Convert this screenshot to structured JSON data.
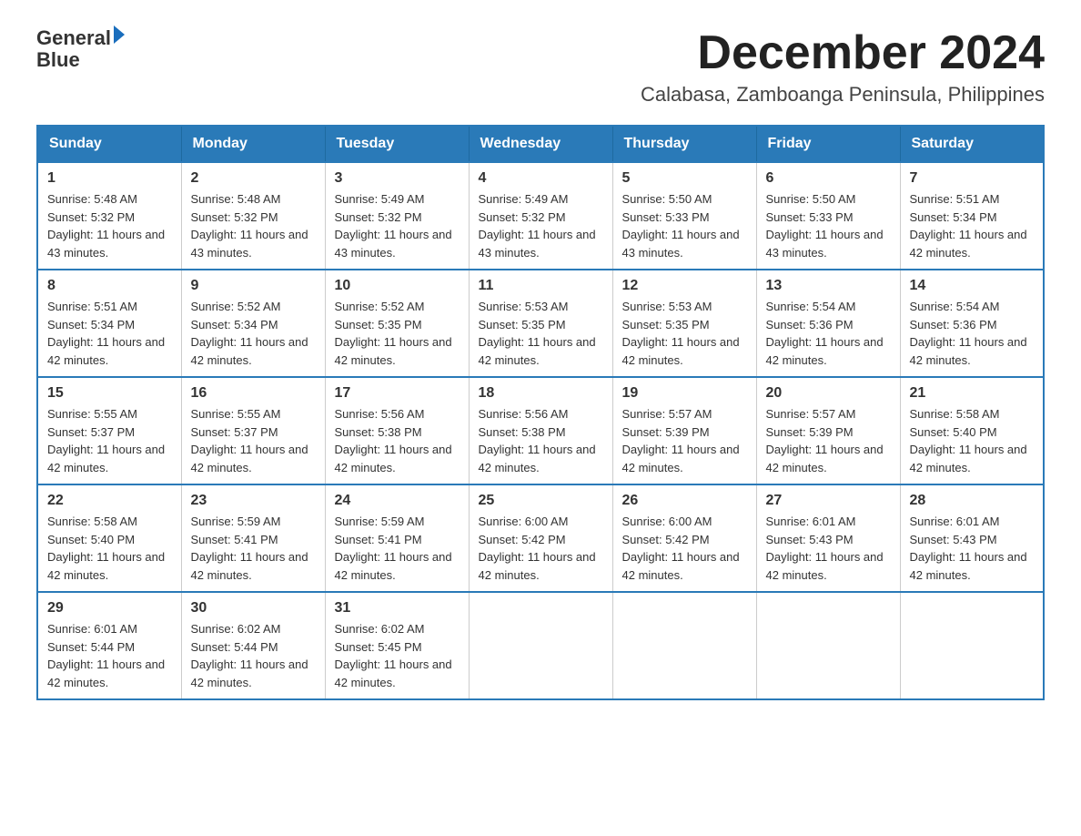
{
  "logo": {
    "text_general": "General",
    "text_blue": "Blue",
    "triangle_color": "#1a6ebd"
  },
  "header": {
    "month_year": "December 2024",
    "location": "Calabasa, Zamboanga Peninsula, Philippines"
  },
  "days_of_week": [
    "Sunday",
    "Monday",
    "Tuesday",
    "Wednesday",
    "Thursday",
    "Friday",
    "Saturday"
  ],
  "weeks": [
    [
      {
        "day": "1",
        "sunrise": "5:48 AM",
        "sunset": "5:32 PM",
        "daylight": "11 hours and 43 minutes."
      },
      {
        "day": "2",
        "sunrise": "5:48 AM",
        "sunset": "5:32 PM",
        "daylight": "11 hours and 43 minutes."
      },
      {
        "day": "3",
        "sunrise": "5:49 AM",
        "sunset": "5:32 PM",
        "daylight": "11 hours and 43 minutes."
      },
      {
        "day": "4",
        "sunrise": "5:49 AM",
        "sunset": "5:32 PM",
        "daylight": "11 hours and 43 minutes."
      },
      {
        "day": "5",
        "sunrise": "5:50 AM",
        "sunset": "5:33 PM",
        "daylight": "11 hours and 43 minutes."
      },
      {
        "day": "6",
        "sunrise": "5:50 AM",
        "sunset": "5:33 PM",
        "daylight": "11 hours and 43 minutes."
      },
      {
        "day": "7",
        "sunrise": "5:51 AM",
        "sunset": "5:34 PM",
        "daylight": "11 hours and 42 minutes."
      }
    ],
    [
      {
        "day": "8",
        "sunrise": "5:51 AM",
        "sunset": "5:34 PM",
        "daylight": "11 hours and 42 minutes."
      },
      {
        "day": "9",
        "sunrise": "5:52 AM",
        "sunset": "5:34 PM",
        "daylight": "11 hours and 42 minutes."
      },
      {
        "day": "10",
        "sunrise": "5:52 AM",
        "sunset": "5:35 PM",
        "daylight": "11 hours and 42 minutes."
      },
      {
        "day": "11",
        "sunrise": "5:53 AM",
        "sunset": "5:35 PM",
        "daylight": "11 hours and 42 minutes."
      },
      {
        "day": "12",
        "sunrise": "5:53 AM",
        "sunset": "5:35 PM",
        "daylight": "11 hours and 42 minutes."
      },
      {
        "day": "13",
        "sunrise": "5:54 AM",
        "sunset": "5:36 PM",
        "daylight": "11 hours and 42 minutes."
      },
      {
        "day": "14",
        "sunrise": "5:54 AM",
        "sunset": "5:36 PM",
        "daylight": "11 hours and 42 minutes."
      }
    ],
    [
      {
        "day": "15",
        "sunrise": "5:55 AM",
        "sunset": "5:37 PM",
        "daylight": "11 hours and 42 minutes."
      },
      {
        "day": "16",
        "sunrise": "5:55 AM",
        "sunset": "5:37 PM",
        "daylight": "11 hours and 42 minutes."
      },
      {
        "day": "17",
        "sunrise": "5:56 AM",
        "sunset": "5:38 PM",
        "daylight": "11 hours and 42 minutes."
      },
      {
        "day": "18",
        "sunrise": "5:56 AM",
        "sunset": "5:38 PM",
        "daylight": "11 hours and 42 minutes."
      },
      {
        "day": "19",
        "sunrise": "5:57 AM",
        "sunset": "5:39 PM",
        "daylight": "11 hours and 42 minutes."
      },
      {
        "day": "20",
        "sunrise": "5:57 AM",
        "sunset": "5:39 PM",
        "daylight": "11 hours and 42 minutes."
      },
      {
        "day": "21",
        "sunrise": "5:58 AM",
        "sunset": "5:40 PM",
        "daylight": "11 hours and 42 minutes."
      }
    ],
    [
      {
        "day": "22",
        "sunrise": "5:58 AM",
        "sunset": "5:40 PM",
        "daylight": "11 hours and 42 minutes."
      },
      {
        "day": "23",
        "sunrise": "5:59 AM",
        "sunset": "5:41 PM",
        "daylight": "11 hours and 42 minutes."
      },
      {
        "day": "24",
        "sunrise": "5:59 AM",
        "sunset": "5:41 PM",
        "daylight": "11 hours and 42 minutes."
      },
      {
        "day": "25",
        "sunrise": "6:00 AM",
        "sunset": "5:42 PM",
        "daylight": "11 hours and 42 minutes."
      },
      {
        "day": "26",
        "sunrise": "6:00 AM",
        "sunset": "5:42 PM",
        "daylight": "11 hours and 42 minutes."
      },
      {
        "day": "27",
        "sunrise": "6:01 AM",
        "sunset": "5:43 PM",
        "daylight": "11 hours and 42 minutes."
      },
      {
        "day": "28",
        "sunrise": "6:01 AM",
        "sunset": "5:43 PM",
        "daylight": "11 hours and 42 minutes."
      }
    ],
    [
      {
        "day": "29",
        "sunrise": "6:01 AM",
        "sunset": "5:44 PM",
        "daylight": "11 hours and 42 minutes."
      },
      {
        "day": "30",
        "sunrise": "6:02 AM",
        "sunset": "5:44 PM",
        "daylight": "11 hours and 42 minutes."
      },
      {
        "day": "31",
        "sunrise": "6:02 AM",
        "sunset": "5:45 PM",
        "daylight": "11 hours and 42 minutes."
      },
      null,
      null,
      null,
      null
    ]
  ]
}
